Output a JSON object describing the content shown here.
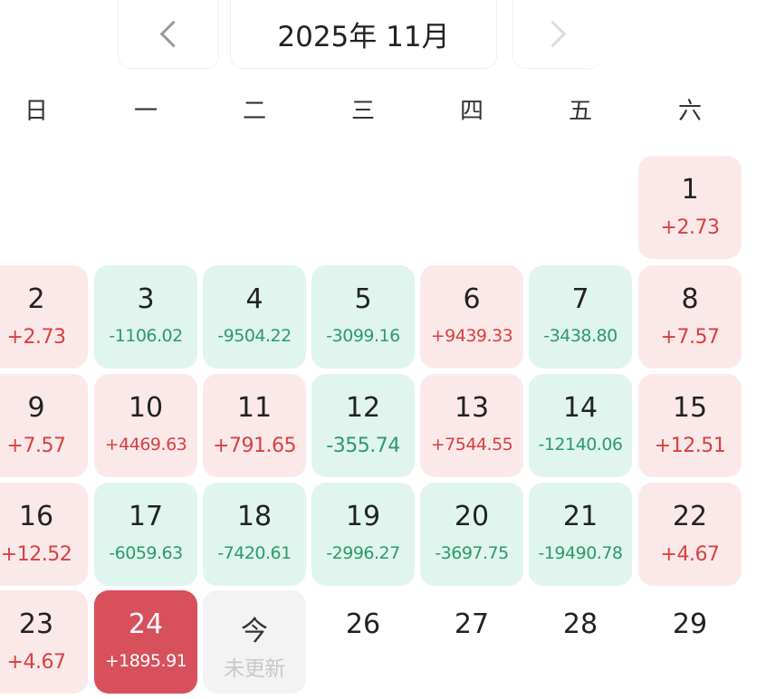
{
  "header": {
    "month_title": "2025年 11月"
  },
  "weekdays": [
    "日",
    "一",
    "二",
    "三",
    "四",
    "五",
    "六"
  ],
  "days": [
    {
      "d": "1",
      "v": "+2.73",
      "t": "pos"
    },
    {
      "d": "2",
      "v": "+2.73",
      "t": "pos"
    },
    {
      "d": "3",
      "v": "-1106.02",
      "t": "neg"
    },
    {
      "d": "4",
      "v": "-9504.22",
      "t": "neg"
    },
    {
      "d": "5",
      "v": "-3099.16",
      "t": "neg"
    },
    {
      "d": "6",
      "v": "+9439.33",
      "t": "pos"
    },
    {
      "d": "7",
      "v": "-3438.80",
      "t": "neg"
    },
    {
      "d": "8",
      "v": "+7.57",
      "t": "pos"
    },
    {
      "d": "9",
      "v": "+7.57",
      "t": "pos"
    },
    {
      "d": "10",
      "v": "+4469.63",
      "t": "pos"
    },
    {
      "d": "11",
      "v": "+791.65",
      "t": "pos"
    },
    {
      "d": "12",
      "v": "-355.74",
      "t": "neg"
    },
    {
      "d": "13",
      "v": "+7544.55",
      "t": "pos"
    },
    {
      "d": "14",
      "v": "-12140.06",
      "t": "neg"
    },
    {
      "d": "15",
      "v": "+12.51",
      "t": "pos"
    },
    {
      "d": "16",
      "v": "+12.52",
      "t": "pos"
    },
    {
      "d": "17",
      "v": "-6059.63",
      "t": "neg"
    },
    {
      "d": "18",
      "v": "-7420.61",
      "t": "neg"
    },
    {
      "d": "19",
      "v": "-2996.27",
      "t": "neg"
    },
    {
      "d": "20",
      "v": "-3697.75",
      "t": "neg"
    },
    {
      "d": "21",
      "v": "-19490.78",
      "t": "neg"
    },
    {
      "d": "22",
      "v": "+4.67",
      "t": "pos"
    },
    {
      "d": "23",
      "v": "+4.67",
      "t": "pos"
    },
    {
      "d": "24",
      "v": "+1895.91",
      "t": "sel"
    },
    {
      "d": "今",
      "v": "未更新",
      "t": "today"
    },
    {
      "d": "26",
      "v": "",
      "t": "plain"
    },
    {
      "d": "27",
      "v": "",
      "t": "plain"
    },
    {
      "d": "28",
      "v": "",
      "t": "plain"
    },
    {
      "d": "29",
      "v": "",
      "t": "plain"
    }
  ],
  "colors": {
    "positive": "#d8403f",
    "negative": "#2e9a6e",
    "selected": "#d7505c"
  },
  "icons": {
    "prev": "chevron-left-icon",
    "next": "chevron-right-icon"
  }
}
